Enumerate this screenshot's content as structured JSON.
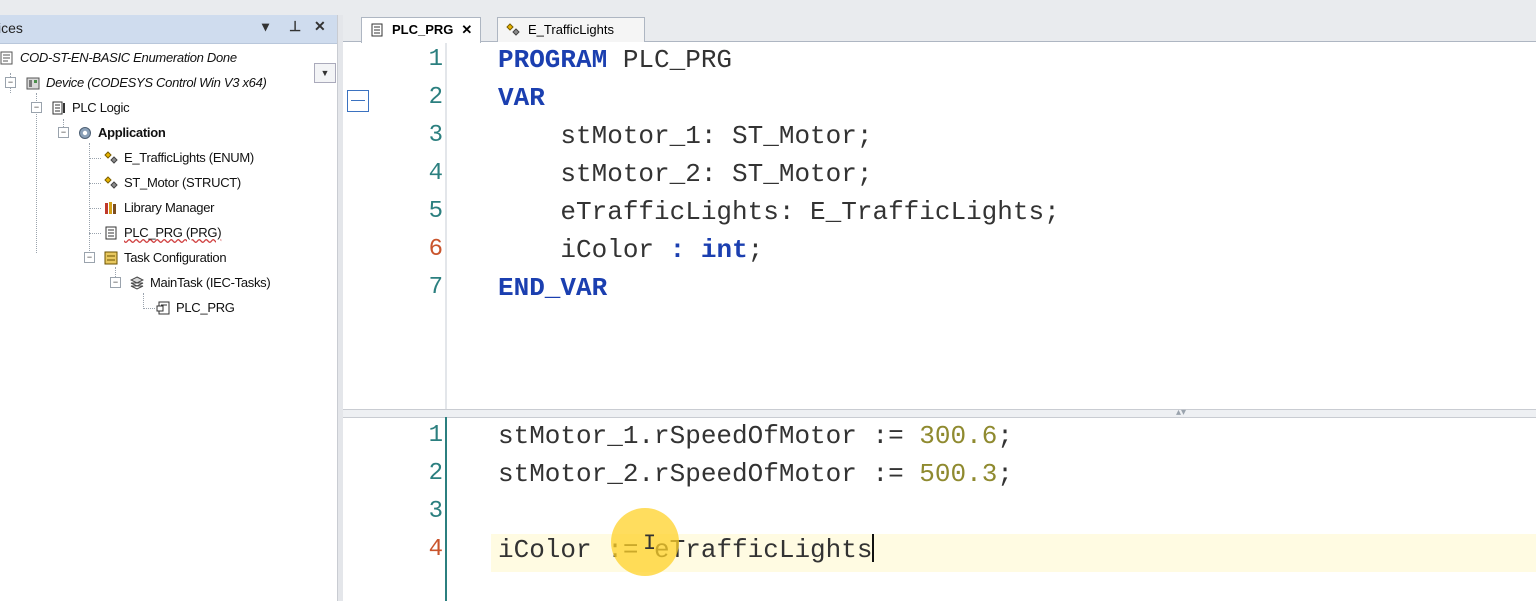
{
  "devices_panel": {
    "title": "ices",
    "buttons": {
      "dropdown": "▾",
      "pin": "⊥",
      "close": "✕"
    },
    "tree": [
      {
        "label": "COD-ST-EN-BASIC Enumeration Done",
        "icon": "project-icon"
      },
      {
        "label": "Device (CODESYS Control Win V3 x64)",
        "icon": "device-icon"
      },
      {
        "label": "PLC Logic",
        "icon": "plc-logic-icon"
      },
      {
        "label": "Application",
        "icon": "application-gear-icon"
      },
      {
        "label": "E_TrafficLights (ENUM)",
        "icon": "enum-icon"
      },
      {
        "label": "ST_Motor (STRUCT)",
        "icon": "struct-icon"
      },
      {
        "label": "Library Manager",
        "icon": "library-icon"
      },
      {
        "label": "PLC_PRG (PRG)",
        "icon": "program-icon"
      },
      {
        "label": "Task Configuration",
        "icon": "task-config-icon"
      },
      {
        "label": "MainTask (IEC-Tasks)",
        "icon": "task-icon"
      },
      {
        "label": "PLC_PRG",
        "icon": "program-call-icon"
      }
    ]
  },
  "editor": {
    "tabs": [
      {
        "label": "PLC_PRG",
        "close": "✕",
        "active": true,
        "icon": "program-icon"
      },
      {
        "label": "E_TrafficLights",
        "active": false,
        "icon": "enum-icon"
      }
    ],
    "declaration": {
      "line_numbers": [
        "1",
        "2",
        "3",
        "4",
        "5",
        "6",
        "7"
      ],
      "lines": [
        [
          "PROGRAM",
          " PLC_PRG"
        ],
        [
          "VAR"
        ],
        [
          "    stMotor_1: ST_Motor;"
        ],
        [
          "    stMotor_2: ST_Motor;"
        ],
        [
          "    eTrafficLights: E_TrafficLights;"
        ],
        [
          "    iColor ",
          ": ",
          "int",
          ";"
        ],
        [
          "END_VAR"
        ]
      ]
    },
    "implementation": {
      "line_numbers": [
        "1",
        "2",
        "3",
        "4"
      ],
      "lines": [
        [
          "stMotor_1.rSpeedOfMotor := ",
          "300.6",
          ";"
        ],
        [
          "stMotor_2.rSpeedOfMotor := ",
          "500.3",
          ";"
        ],
        [
          ""
        ],
        [
          "iColor ",
          ":= ",
          "eTrafficLights"
        ]
      ]
    },
    "splitter_grip": "▴▾"
  },
  "colors": {
    "keyword": "#1b3fb0",
    "number": "#8f8a2f",
    "line_number": "#2b7f7f",
    "panel_header": "#cfdcee",
    "current_line": "#fffbe2",
    "cursor_highlight": "#ffd228"
  }
}
